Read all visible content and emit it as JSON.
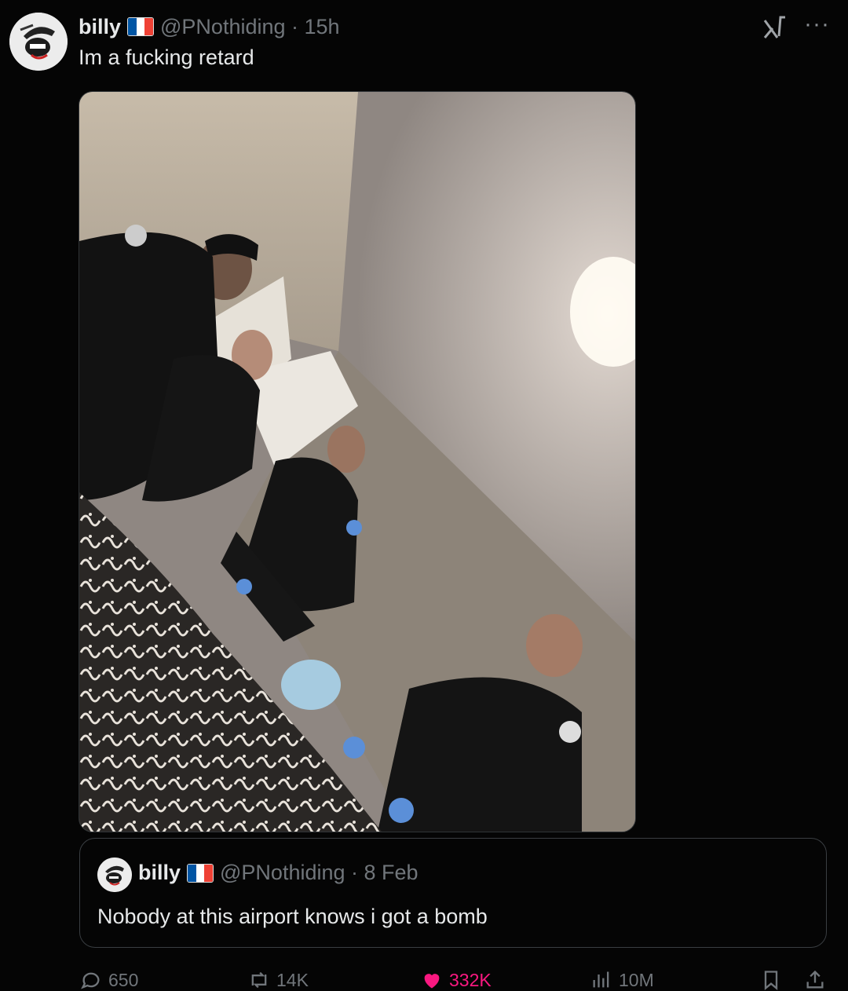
{
  "tweet": {
    "author_name": "billy",
    "handle_time": "@PNothiding · 15h",
    "text": "Im a fucking retard"
  },
  "quoted": {
    "author_name": "billy",
    "handle_time": "@PNothiding · 8 Feb",
    "text": "Nobody at this airport knows i got a bomb"
  },
  "actions": {
    "replies": "650",
    "reposts": "14K",
    "likes": "332K",
    "views": "10M"
  },
  "colors": {
    "like": "#f91880",
    "muted": "#71767b",
    "flag_blue": "#0055a4",
    "flag_red": "#ef4135"
  },
  "icons": [
    "grok-icon",
    "more-icon",
    "reply-icon",
    "repost-icon",
    "like-icon",
    "views-icon",
    "bookmark-icon",
    "share-icon"
  ]
}
